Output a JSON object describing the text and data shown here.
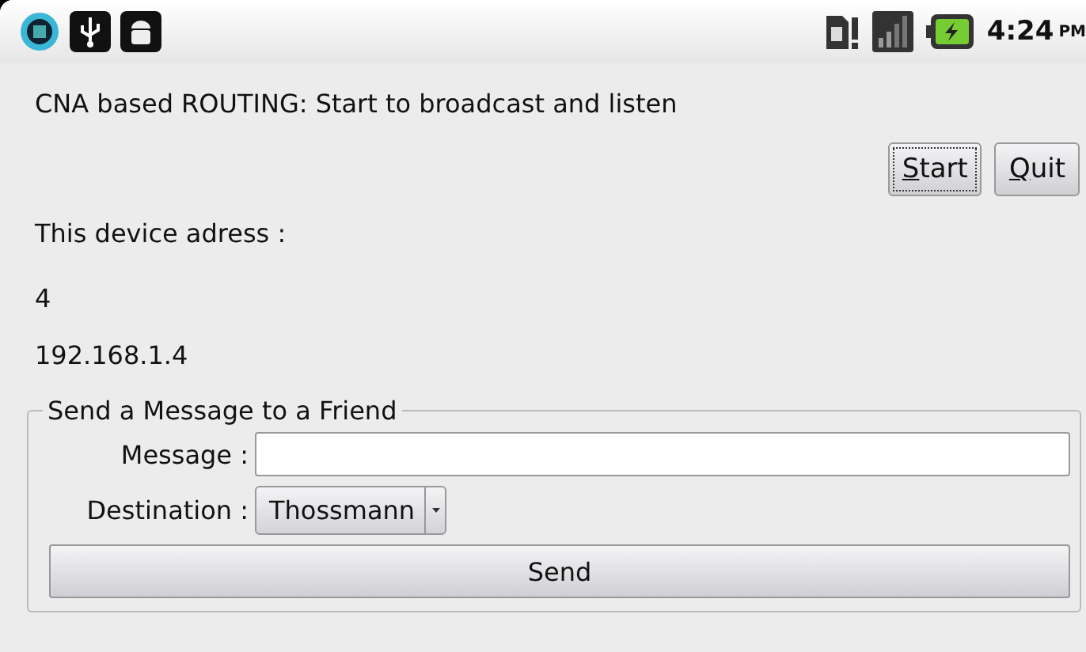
{
  "status_bar": {
    "time": "4:24",
    "meridiem": "PM"
  },
  "title": "CNA based ROUTING: Start to broadcast and listen",
  "buttons": [
    {
      "mnemonic": "S",
      "rest": "tart",
      "focused": true
    },
    {
      "mnemonic": "Q",
      "rest": "uit",
      "focused": false
    }
  ],
  "device_label": "This device adress :",
  "device_id": "4",
  "device_ip": "192.168.1.4",
  "group": {
    "title": "Send a Message to a Friend",
    "message_label": "Message :",
    "destination_label": "Destination :",
    "destination": "Thossmann",
    "send": "Send"
  }
}
